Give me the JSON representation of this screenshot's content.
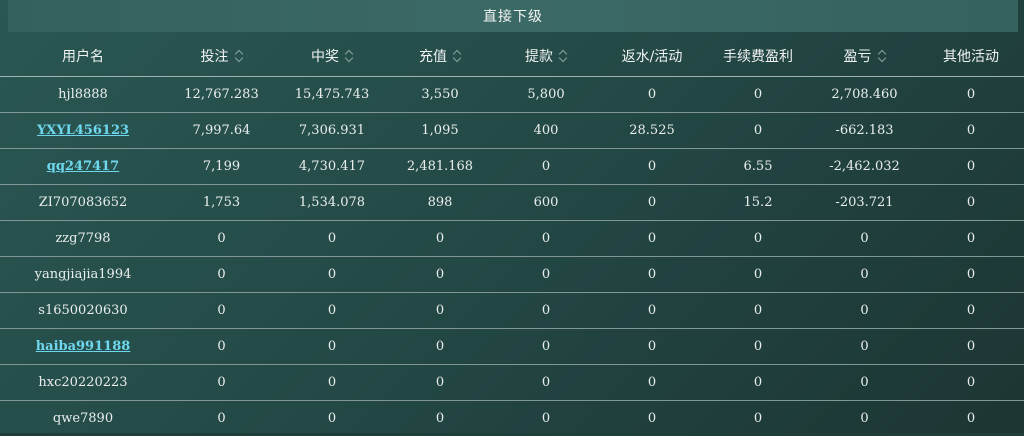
{
  "title": "直接下级",
  "headers": [
    {
      "label": "用户名",
      "sortable": false
    },
    {
      "label": "投注",
      "sortable": true
    },
    {
      "label": "中奖",
      "sortable": true
    },
    {
      "label": "充值",
      "sortable": true
    },
    {
      "label": "提款",
      "sortable": true
    },
    {
      "label": "返水/活动",
      "sortable": false
    },
    {
      "label": "手续费盈利",
      "sortable": false
    },
    {
      "label": "盈亏",
      "sortable": true
    },
    {
      "label": "其他活动",
      "sortable": false
    }
  ],
  "rows": [
    {
      "user": "hjl8888",
      "link": false,
      "bet": "12,767.283",
      "win": "15,475.743",
      "deposit": "3,550",
      "withdraw": "5,800",
      "rebate": "0",
      "fee_profit": "0",
      "pnl": "2,708.460",
      "other": "0"
    },
    {
      "user": "YXYL456123",
      "link": true,
      "bet": "7,997.64",
      "win": "7,306.931",
      "deposit": "1,095",
      "withdraw": "400",
      "rebate": "28.525",
      "fee_profit": "0",
      "pnl": "-662.183",
      "other": "0"
    },
    {
      "user": "qq247417",
      "link": true,
      "bet": "7,199",
      "win": "4,730.417",
      "deposit": "2,481.168",
      "withdraw": "0",
      "rebate": "0",
      "fee_profit": "6.55",
      "pnl": "-2,462.032",
      "other": "0"
    },
    {
      "user": "ZI707083652",
      "link": false,
      "bet": "1,753",
      "win": "1,534.078",
      "deposit": "898",
      "withdraw": "600",
      "rebate": "0",
      "fee_profit": "15.2",
      "pnl": "-203.721",
      "other": "0"
    },
    {
      "user": "zzg7798",
      "link": false,
      "bet": "0",
      "win": "0",
      "deposit": "0",
      "withdraw": "0",
      "rebate": "0",
      "fee_profit": "0",
      "pnl": "0",
      "other": "0"
    },
    {
      "user": "yangjiajia1994",
      "link": false,
      "bet": "0",
      "win": "0",
      "deposit": "0",
      "withdraw": "0",
      "rebate": "0",
      "fee_profit": "0",
      "pnl": "0",
      "other": "0"
    },
    {
      "user": "s1650020630",
      "link": false,
      "bet": "0",
      "win": "0",
      "deposit": "0",
      "withdraw": "0",
      "rebate": "0",
      "fee_profit": "0",
      "pnl": "0",
      "other": "0"
    },
    {
      "user": "haiba991188",
      "link": true,
      "bet": "0",
      "win": "0",
      "deposit": "0",
      "withdraw": "0",
      "rebate": "0",
      "fee_profit": "0",
      "pnl": "0",
      "other": "0"
    },
    {
      "user": "hxc20220223",
      "link": false,
      "bet": "0",
      "win": "0",
      "deposit": "0",
      "withdraw": "0",
      "rebate": "0",
      "fee_profit": "0",
      "pnl": "0",
      "other": "0"
    },
    {
      "user": "qwe7890",
      "link": false,
      "bet": "0",
      "win": "0",
      "deposit": "0",
      "withdraw": "0",
      "rebate": "0",
      "fee_profit": "0",
      "pnl": "0",
      "other": "0"
    }
  ]
}
